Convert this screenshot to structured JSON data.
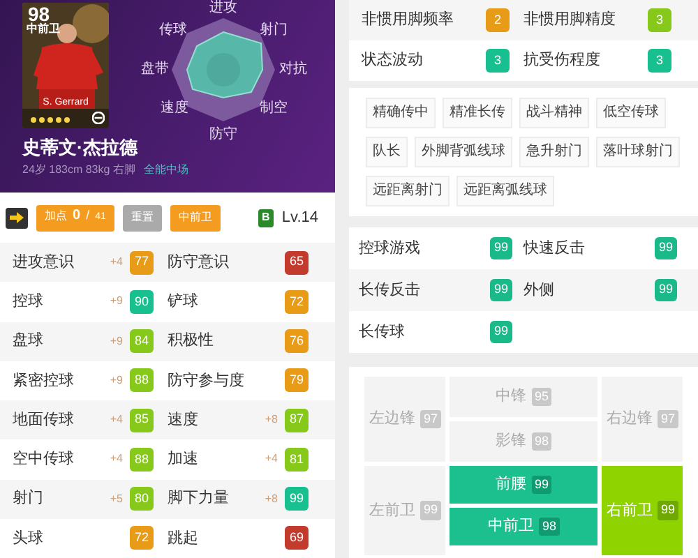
{
  "player_card": {
    "rating": "98",
    "position": "中前卫",
    "name": "S. Gerrard",
    "stars": 5
  },
  "radar": {
    "labels": [
      "进攻",
      "射门",
      "对抗",
      "制空",
      "防守",
      "速度",
      "盘带",
      "传球"
    ]
  },
  "player": {
    "name": "史蒂文·杰拉德",
    "info": "24岁 183cm 83kg 右脚",
    "role": "全能中场"
  },
  "toolbar": {
    "points_label": "加点",
    "points": "0",
    "points_sep": "/",
    "points_total": "41",
    "reset": "重置",
    "position": "中前卫",
    "grade": "B",
    "level": "Lv.14"
  },
  "stats": [
    [
      {
        "label": "进攻意识",
        "bonus": "+4",
        "value": "77",
        "color": "#e89b16"
      },
      {
        "label": "防守意识",
        "value": "65",
        "color": "#c23b2c"
      }
    ],
    [
      {
        "label": "控球",
        "bonus": "+9",
        "value": "90",
        "color": "#19c08f"
      },
      {
        "label": "铲球",
        "value": "72",
        "color": "#e89b16"
      }
    ],
    [
      {
        "label": "盘球",
        "bonus": "+9",
        "value": "84",
        "color": "#86c91b"
      },
      {
        "label": "积极性",
        "value": "76",
        "color": "#e89b16"
      }
    ],
    [
      {
        "label": "紧密控球",
        "bonus": "+9",
        "value": "88",
        "color": "#86c91b"
      },
      {
        "label": "防守参与度",
        "value": "79",
        "color": "#e89b16"
      }
    ],
    [
      {
        "label": "地面传球",
        "bonus": "+4",
        "value": "85",
        "color": "#86c91b"
      },
      {
        "label": "速度",
        "bonus": "+8",
        "value": "87",
        "color": "#86c91b"
      }
    ],
    [
      {
        "label": "空中传球",
        "bonus": "+4",
        "value": "88",
        "color": "#86c91b"
      },
      {
        "label": "加速",
        "bonus": "+4",
        "value": "81",
        "color": "#86c91b"
      }
    ],
    [
      {
        "label": "射门",
        "bonus": "+5",
        "value": "80",
        "color": "#86c91b"
      },
      {
        "label": "脚下力量",
        "bonus": "+8",
        "value": "99",
        "color": "#19c08f"
      }
    ],
    [
      {
        "label": "头球",
        "value": "72",
        "color": "#e89b16"
      },
      {
        "label": "跳起",
        "value": "69",
        "color": "#c23b2c"
      }
    ]
  ],
  "traits": [
    [
      {
        "label": "非惯用脚频率",
        "value": "2",
        "color": "#e89b16"
      },
      {
        "label": "非惯用脚精度",
        "value": "3",
        "color": "#86c91b"
      }
    ],
    [
      {
        "label": "状态波动",
        "value": "3",
        "color": "#19c08f"
      },
      {
        "label": "抗受伤程度",
        "value": "3",
        "color": "#19c08f"
      }
    ]
  ],
  "skills": [
    "精确传中",
    "精准长传",
    "战斗精神",
    "低空传球",
    "队长",
    "外脚背弧线球",
    "急升射门",
    "落叶球射门",
    "远距离射门",
    "远距离弧线球"
  ],
  "play_styles": [
    {
      "label": "控球游戏",
      "value": "99"
    },
    {
      "label": "快速反击",
      "value": "99"
    },
    {
      "label": "长传反击",
      "value": "99"
    },
    {
      "label": "外侧",
      "value": "99"
    },
    {
      "label": "长传球",
      "value": "99"
    }
  ],
  "positions": {
    "top": {
      "left": {
        "label": "左边锋",
        "value": "97",
        "kind": "none"
      },
      "center": [
        {
          "label": "中锋",
          "value": "95",
          "kind": "none"
        },
        {
          "label": "影锋",
          "value": "98",
          "kind": "none"
        }
      ],
      "right": {
        "label": "右边锋",
        "value": "97",
        "kind": "none"
      }
    },
    "bottom": {
      "left": {
        "label": "左前卫",
        "value": "99",
        "kind": "none"
      },
      "center": [
        {
          "label": "前腰",
          "value": "99",
          "kind": "primary"
        },
        {
          "label": "中前卫",
          "value": "98",
          "kind": "primary"
        }
      ],
      "right": {
        "label": "右前卫",
        "value": "99",
        "kind": "secondary"
      }
    }
  }
}
